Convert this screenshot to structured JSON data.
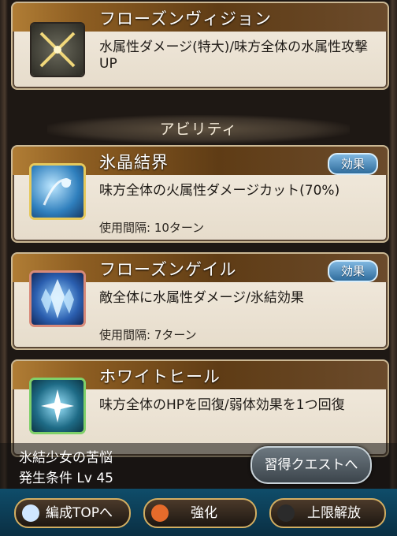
{
  "support": {
    "title": "フローズンヴィジョン",
    "desc": "水属性ダメージ(特大)/味方全体の水属性攻撃UP"
  },
  "section_label": "アビリティ",
  "abilities": [
    {
      "title": "氷晶結界",
      "badge": "効果",
      "desc": "味方全体の火属性ダメージカット(70%)",
      "cooldown": "使用間隔: 10ターン"
    },
    {
      "title": "フローズンゲイル",
      "badge": "効果",
      "desc": "敵全体に水属性ダメージ/氷結効果",
      "cooldown": "使用間隔: 7ターン"
    },
    {
      "title": "ホワイトヒール",
      "desc": "味方全体のHPを回復/弱体効果を1つ回復"
    }
  ],
  "quest": {
    "name": "氷結少女の苦悩",
    "condition": "発生条件 Lv 45",
    "button": "習得クエストへ"
  },
  "bottom_nav": [
    {
      "label": "編成TOPへ",
      "icon": "party-icon"
    },
    {
      "label": "強化",
      "icon": "upgrade-arrow-icon"
    },
    {
      "label": "上限解放",
      "icon": "stars-icon"
    }
  ]
}
